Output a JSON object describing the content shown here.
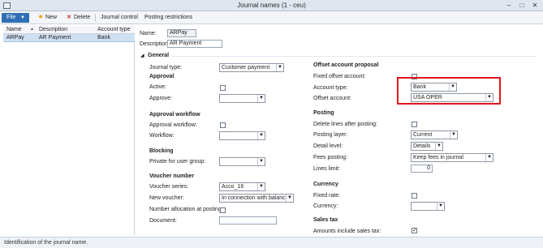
{
  "window": {
    "title": "Journal names (1 - ceu)",
    "controls": [
      "–",
      "□",
      "✕"
    ]
  },
  "toolbar": {
    "file_label": "File",
    "new_label": "New",
    "delete_label": "Delete",
    "journal_control_label": "Journal control",
    "posting_restrictions_label": "Posting restrictions"
  },
  "grid": {
    "columns": [
      "Name",
      "Description",
      "Account type"
    ],
    "rows": [
      {
        "name": "ARPay",
        "description": "AR Payment",
        "account_type": "Bank"
      }
    ]
  },
  "header_fields": {
    "name_label": "Name:",
    "name_value": "ARPay",
    "description_label": "Description:",
    "description_value": "AR Payment"
  },
  "general": {
    "section_label": "General",
    "journal_type_label": "Journal type:",
    "journal_type_value": "Customer payment",
    "approval": {
      "heading": "Approval",
      "active_label": "Active:",
      "approve_label": "Approve:",
      "approve_value": ""
    },
    "approval_workflow": {
      "heading": "Approval workflow",
      "approval_workflow_label": "Approval workflow:",
      "workflow_label": "Workflow:",
      "workflow_value": ""
    },
    "blocking": {
      "heading": "Blocking",
      "private_label": "Private for user group:",
      "private_value": ""
    },
    "voucher_number": {
      "heading": "Voucher number",
      "voucher_series_label": "Voucher series:",
      "voucher_series_value": "Acco_16",
      "new_voucher_label": "New voucher:",
      "new_voucher_value": "In connection with balance",
      "number_allocation_label": "Number allocation at posting:",
      "document_label": "Document:",
      "document_value": ""
    },
    "offset_account_proposal": {
      "heading": "Offset account proposal",
      "fixed_offset_label": "Fixed offset account:",
      "account_type_label": "Account type:",
      "account_type_value": "Bank",
      "offset_account_label": "Offset account:",
      "offset_account_value": "USA OPER"
    },
    "posting": {
      "heading": "Posting",
      "delete_lines_label": "Delete lines after posting:",
      "posting_layer_label": "Posting layer:",
      "posting_layer_value": "Current",
      "detail_level_label": "Detail level:",
      "detail_level_value": "Details",
      "fees_posting_label": "Fees posting:",
      "fees_posting_value": "Keep fees in journal",
      "lines_limit_label": "Lines limit:",
      "lines_limit_value": "0"
    },
    "currency": {
      "heading": "Currency",
      "fixed_rate_label": "Fixed rate:",
      "currency_label": "Currency:",
      "currency_value": ""
    },
    "sales_tax": {
      "heading": "Sales tax",
      "amounts_include_label": "Amounts include sales tax:",
      "amounts_include_checked": true
    }
  },
  "statusbar": {
    "text": "Identification of the journal name."
  },
  "colors": {
    "accent": "#2f6fb5",
    "highlight": "#e0141e",
    "selected_row": "#cfe0f3"
  }
}
